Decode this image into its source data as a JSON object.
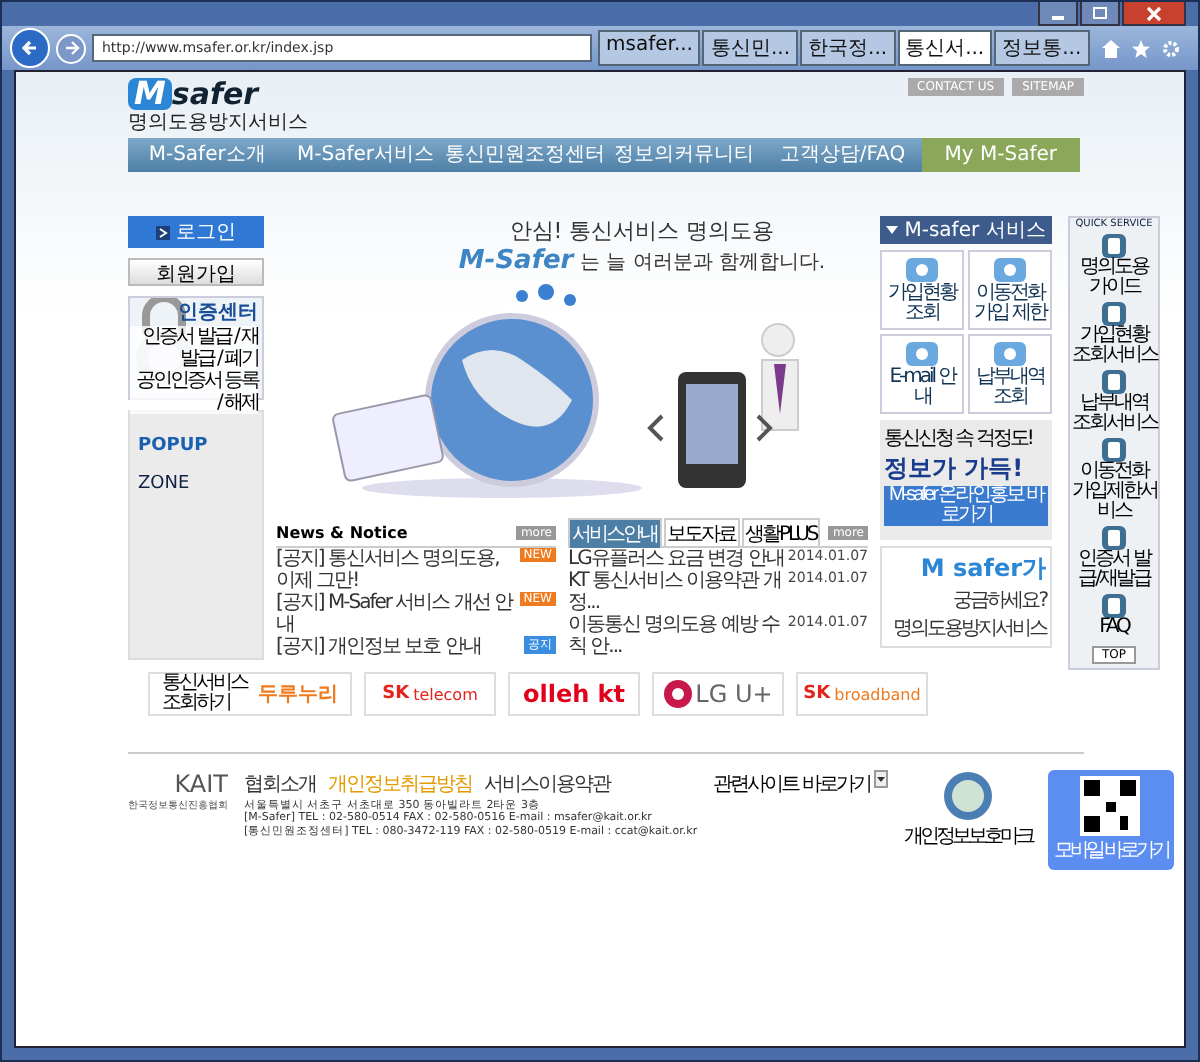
{
  "browser": {
    "url": "http://www.msafer.or.kr/index.jsp",
    "tabs": [
      {
        "label": "msafer...",
        "selected": false
      },
      {
        "label": "통신민...",
        "selected": false
      },
      {
        "label": "한국정...",
        "selected": false
      },
      {
        "label": "통신서...",
        "selected": true
      },
      {
        "label": "정보통...",
        "selected": false
      }
    ]
  },
  "header": {
    "links": [
      "CONTACT US",
      "SITEMAP"
    ],
    "logo_mark": "M",
    "logo_text": "safer",
    "logo_sub": "명의도용방지서비스"
  },
  "nav": [
    {
      "label": "M-Safer소개",
      "selected": false
    },
    {
      "label": "M-Safer서비스",
      "selected": false
    },
    {
      "label": "통신민원조정센터",
      "selected": false
    },
    {
      "label": "정보의커뮤니티",
      "selected": false
    },
    {
      "label": "고객상담/FAQ",
      "selected": false
    },
    {
      "label": "My M-Safer",
      "selected": true
    }
  ],
  "left": {
    "login": "로그인",
    "join": "회원가입",
    "cert": {
      "title": "인증센터",
      "items": [
        "인증서 발급 / 재발급 / 폐기",
        "공인인증서 등록 / 해제"
      ]
    },
    "popup": {
      "heading": "POPUP",
      "subheading": "ZONE"
    }
  },
  "hero": {
    "line1": "안심! 통신서비스 명의도용",
    "brand": "M-Safer",
    "line2": "는 늘 여러분과 함께합니다."
  },
  "services": {
    "title": "M-safer 서비스",
    "tiles": [
      "가입현황 조회",
      "이동전화 가입 제한",
      "E-mail 안내",
      "납부내역 조회"
    ]
  },
  "banner": {
    "line1": "통신신청 속 걱정도!",
    "line2": "정보가 가득!",
    "button": "M-safer 온라인홍보 바로가기"
  },
  "qa_banner": {
    "brand": "M safer가",
    "line1": "궁금하세요?",
    "line2": "명의도용방지서비스"
  },
  "quick": {
    "title": "QUICK SERVICE",
    "items": [
      "명의도용 가이드",
      "가입현황 조회서비스",
      "납부내역 조회서비스",
      "이동전화 가입제한서비스",
      "인증서 발급/재발급",
      "FAQ"
    ],
    "top": "TOP"
  },
  "news": {
    "title": "News & Notice",
    "more": "more",
    "items": [
      {
        "text": "[공지] 통신서비스 명의도용, 이제 그만!",
        "badge": "NEW",
        "color": "#f07a1e"
      },
      {
        "text": "[공지] M-Safer 서비스 개선 안내",
        "badge": "NEW",
        "color": "#f07a1e"
      },
      {
        "text": "[공지] 개인정보 보호 안내",
        "badge": "공지",
        "color": "#3a8ee0"
      }
    ]
  },
  "board": {
    "tabs": [
      {
        "label": "서비스안내",
        "selected": true
      },
      {
        "label": "보도자료",
        "selected": false
      },
      {
        "label": "생활PLUS",
        "selected": false
      }
    ],
    "more": "more",
    "items": [
      {
        "text": "LG유플러스 요금 변경 안내",
        "date": "2014.01.07"
      },
      {
        "text": "KT 통신서비스 이용약관 개정...",
        "date": "2014.01.07"
      },
      {
        "text": "이동통신 명의도용 예방 수칙 안...",
        "date": "2014.01.07"
      }
    ]
  },
  "partners": [
    {
      "name": "두루누리",
      "kind": "duru",
      "sub": "통신서비스 조회하기"
    },
    {
      "name": "telecom",
      "kind": "skt",
      "sub": "SK"
    },
    {
      "name": "olleh kt",
      "kind": "kt"
    },
    {
      "name": "LG U+",
      "kind": "lg"
    },
    {
      "name": "broadband",
      "kind": "skb",
      "sub": "SK"
    }
  ],
  "footer": {
    "org": "KAIT",
    "org_sub": "한국정보통신진흥협회",
    "links": [
      {
        "label": "협회소개",
        "highlight": false
      },
      {
        "label": "개인정보취급방침",
        "highlight": true
      },
      {
        "label": "서비스이용약관",
        "highlight": false
      }
    ],
    "address": [
      "서울특별시 서초구 서초대로 350 동아빌라트 2타운 3층",
      "[M-Safer] TEL : 02-580-0514 FAX : 02-580-0516 E-mail : msafer@kait.or.kr",
      "[통신민원조정센터] TEL : 080-3472-119 FAX : 02-580-0519 E-mail : ccat@kait.or.kr"
    ],
    "related": "관련사이트 바로가기",
    "mark": "개인정보보호마크",
    "qr_label": "모바일 바로가기"
  }
}
